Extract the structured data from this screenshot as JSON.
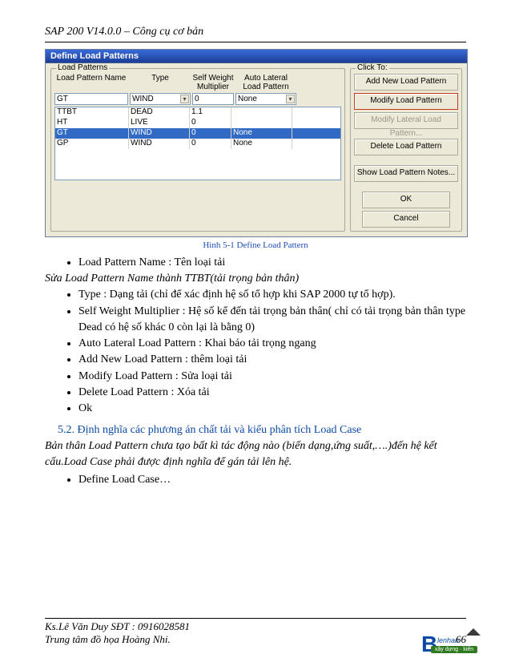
{
  "header": {
    "title": "SAP 200 V14.0.0 – Công cụ cơ bản"
  },
  "dialog": {
    "title": "Define Load Patterns",
    "load_panel_label": "Load Patterns",
    "click_panel_label": "Click To:",
    "columns": {
      "name": "Load Pattern Name",
      "type": "Type",
      "self_weight": "Self Weight\nMultiplier",
      "auto": "Auto Lateral\nLoad Pattern"
    },
    "input_row": {
      "name": "GT",
      "type": "WIND",
      "self_weight": "0",
      "auto": "None"
    },
    "rows": [
      {
        "name": "TTBT",
        "type": "DEAD",
        "self_weight": "1.1",
        "auto": "",
        "selected": false
      },
      {
        "name": "HT",
        "type": "LIVE",
        "self_weight": "0",
        "auto": "",
        "selected": false
      },
      {
        "name": "GT",
        "type": "WIND",
        "self_weight": "0",
        "auto": "None",
        "selected": true
      },
      {
        "name": "GP",
        "type": "WIND",
        "self_weight": "0",
        "auto": "None",
        "selected": false
      }
    ],
    "buttons": {
      "add": "Add New Load Pattern",
      "modify": "Modify Load Pattern",
      "modify_lateral": "Modify Lateral Load Pattern...",
      "delete": "Delete Load Pattern",
      "notes": "Show Load Pattern Notes...",
      "ok": "OK",
      "cancel": "Cancel"
    }
  },
  "caption": "Hình 5-1 Define Load Pattern",
  "bullets1": {
    "b0": "Load Pattern Name : Tên loại tải"
  },
  "italic1": "Sửa Load Pattern Name thành TTBT(tải trọng bản thân)",
  "bullets2": {
    "b0": "Type : Dạng tải (chỉ để xác định hệ số tổ hợp khi SAP 2000 tự tổ hợp).",
    "b1": "Self  Weight Multiplier : Hệ số kể đến tải trọng bản thân( chỉ có tải trọng bản thân type Dead có hệ số khác 0 còn lại là bằng 0)",
    "b2": "Auto Lateral Load Pattern : Khai báo tải trọng ngang",
    "b3": "Add New Load Pattern : thêm loại tải",
    "b4": "Modify Load Pattern : Sửa loại tải",
    "b5": "Delete Load Pattern : Xóa tải",
    "b6": "Ok"
  },
  "section": "5.2. Định nghĩa các phương án chất tải  và kiểu phân tích  Load Case",
  "body_italic": "Bản thân Load Pattern chưa tạo bất kì tác động nào (biến dạng,ứng suất,….)đến hệ kết cấu.Load Case phải được định nghĩa để gán tải lên hệ.",
  "bullets3": {
    "b0": "Define Load Case…"
  },
  "footer": {
    "line1": "Ks.Lê Văn Duy SĐT : 0916028581",
    "line2": "Trung tâm đồ họa Hoàng Nhi.",
    "page": "66"
  },
  "logo": {
    "big": "B",
    "word": "lenhan",
    "bar": "xây dựng · kiến trúc"
  }
}
